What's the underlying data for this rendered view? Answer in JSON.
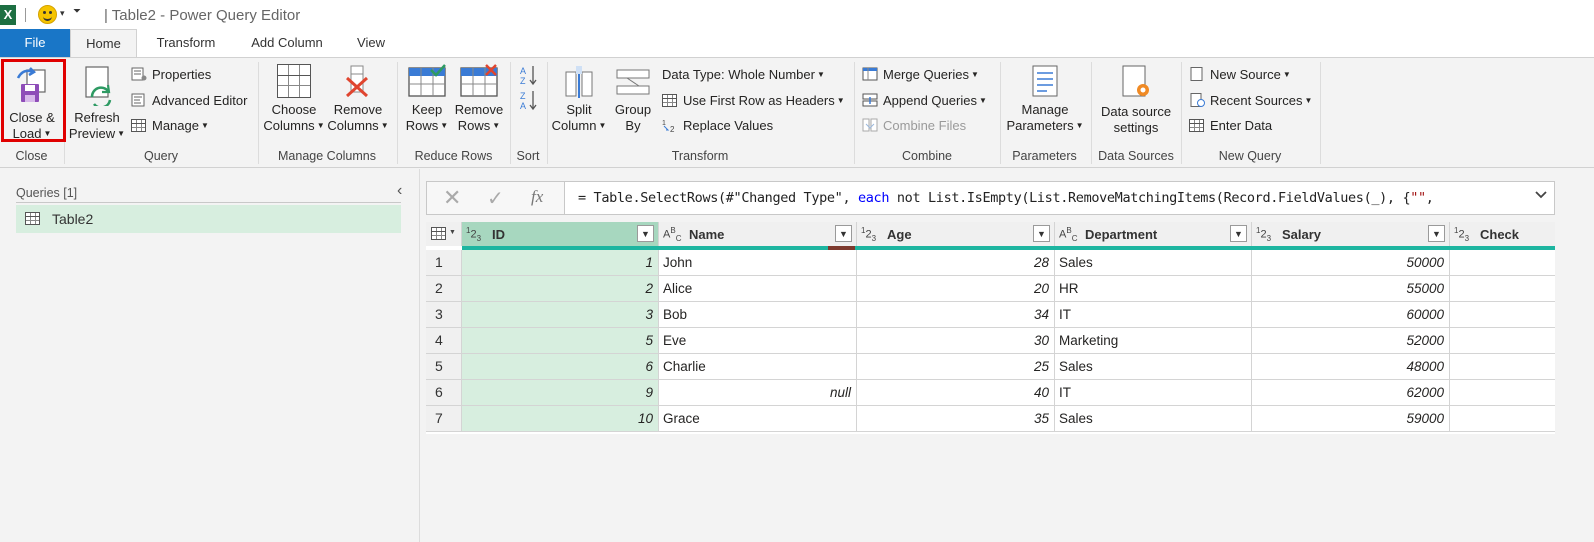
{
  "titlebar": {
    "title": "| Table2 - Power Query Editor",
    "app_icon": "X"
  },
  "tabs": [
    "File",
    "Home",
    "Transform",
    "Add Column",
    "View"
  ],
  "ribbon": {
    "close_group": {
      "close_load_line1": "Close &",
      "close_load_line2": "Load",
      "label": "Close"
    },
    "query_group": {
      "refresh_line1": "Refresh",
      "refresh_line2": "Preview",
      "properties": "Properties",
      "advanced_editor": "Advanced Editor",
      "manage": "Manage",
      "label": "Query"
    },
    "manage_columns_group": {
      "choose_line1": "Choose",
      "choose_line2": "Columns",
      "remove_line1": "Remove",
      "remove_line2": "Columns",
      "label": "Manage Columns"
    },
    "reduce_rows_group": {
      "keep_line1": "Keep",
      "keep_line2": "Rows",
      "remove_line1": "Remove",
      "remove_line2": "Rows",
      "label": "Reduce Rows"
    },
    "sort_group": {
      "label": "Sort"
    },
    "transform_group": {
      "split_line1": "Split",
      "split_line2": "Column",
      "group_line1": "Group",
      "group_line2": "By",
      "data_type": "Data Type: Whole Number",
      "use_first_row": "Use First Row as Headers",
      "replace_values": "Replace Values",
      "label": "Transform"
    },
    "combine_group": {
      "merge": "Merge Queries",
      "append": "Append Queries",
      "combine_files": "Combine Files",
      "label": "Combine"
    },
    "parameters_group": {
      "manage_line1": "Manage",
      "manage_line2": "Parameters",
      "label": "Parameters"
    },
    "data_sources_group": {
      "line1": "Data source",
      "line2": "settings",
      "label": "Data Sources"
    },
    "new_query_group": {
      "new_source": "New Source",
      "recent_sources": "Recent Sources",
      "enter_data": "Enter Data",
      "label": "New Query"
    }
  },
  "queries_pane": {
    "header": "Queries [1]",
    "items": [
      "Table2"
    ]
  },
  "formula_bar": {
    "prefix": "= Table.SelectRows(#\"Changed Type\", ",
    "kw_each": "each",
    "middle": " not List.IsEmpty(List.RemoveMatchingItems(Record.FieldValues(_), {",
    "str": "\"\"",
    "suffix": ","
  },
  "grid": {
    "columns": [
      {
        "name": "ID",
        "type": "123"
      },
      {
        "name": "Name",
        "type": "ABC"
      },
      {
        "name": "Age",
        "type": "123"
      },
      {
        "name": "Department",
        "type": "ABC"
      },
      {
        "name": "Salary",
        "type": "123"
      },
      {
        "name": "Check",
        "type": "123"
      }
    ],
    "rows": [
      {
        "n": "1",
        "id": "1",
        "name": "John",
        "age": "28",
        "dept": "Sales",
        "salary": "50000"
      },
      {
        "n": "2",
        "id": "2",
        "name": "Alice",
        "age": "20",
        "dept": "HR",
        "salary": "55000"
      },
      {
        "n": "3",
        "id": "3",
        "name": "Bob",
        "age": "34",
        "dept": "IT",
        "salary": "60000"
      },
      {
        "n": "4",
        "id": "5",
        "name": "Eve",
        "age": "30",
        "dept": "Marketing",
        "salary": "52000"
      },
      {
        "n": "5",
        "id": "6",
        "name": "Charlie",
        "age": "25",
        "dept": "Sales",
        "salary": "48000"
      },
      {
        "n": "6",
        "id": "9",
        "name": "null",
        "age": "40",
        "dept": "IT",
        "salary": "62000"
      },
      {
        "n": "7",
        "id": "10",
        "name": "Grace",
        "age": "35",
        "dept": "Sales",
        "salary": "59000"
      }
    ]
  },
  "colors": {
    "file_tab": "#1976c7",
    "highlight": "#e00000",
    "selected_column": "#d7eedf",
    "quality_bar": "#1db5a0"
  }
}
